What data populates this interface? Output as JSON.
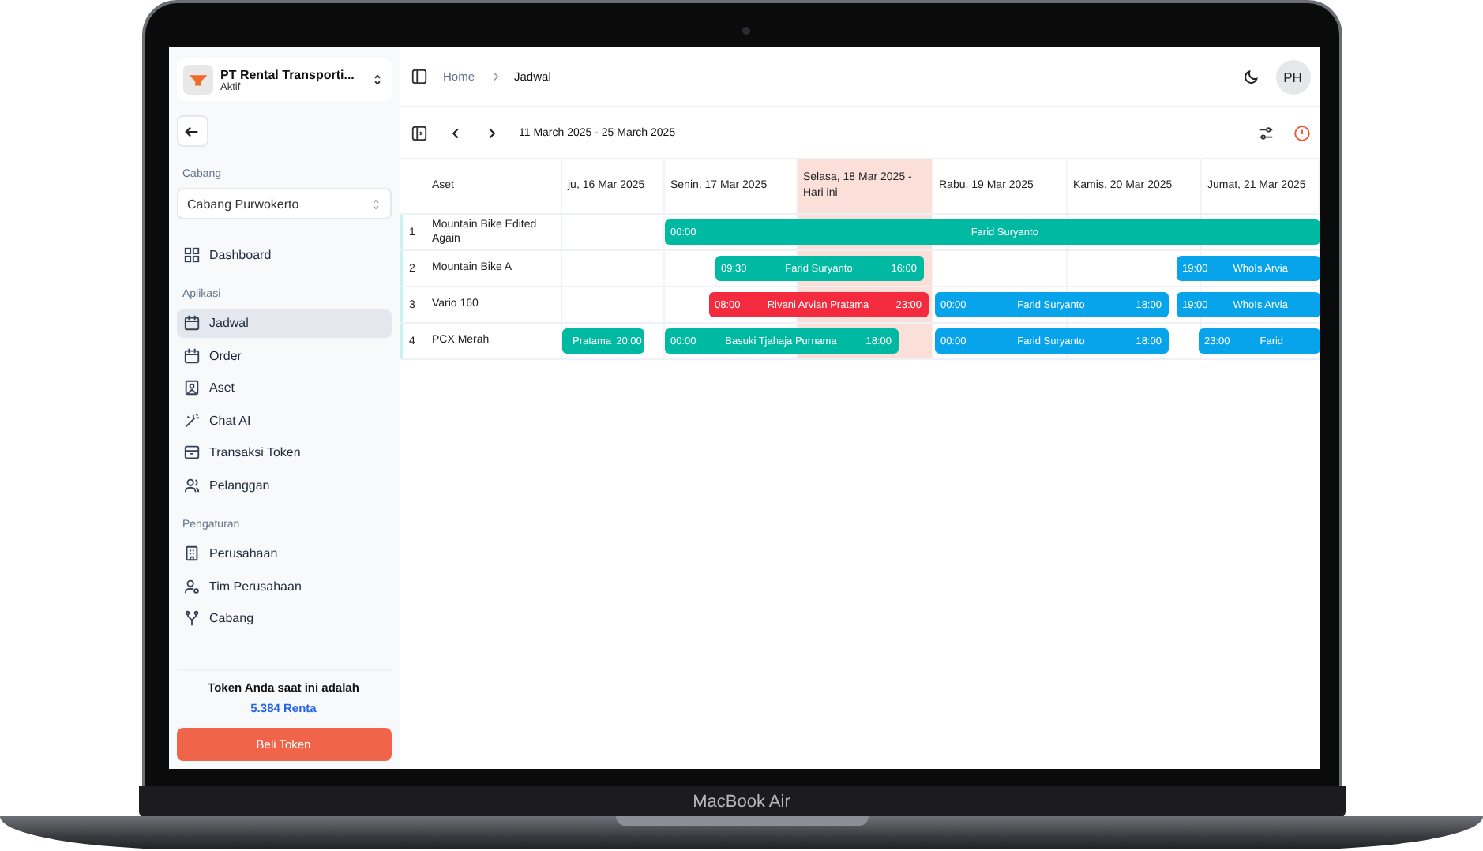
{
  "device": {
    "label": "MacBook Air"
  },
  "sidebar": {
    "company": {
      "name": "PT Rental Transporti...",
      "status": "Aktif"
    },
    "branch_label": "Cabang",
    "branch": "Cabang Purwokerto",
    "top_items": [
      {
        "label": "Dashboard",
        "selected": false
      }
    ],
    "sections": [
      {
        "title": "Aplikasi",
        "items": [
          {
            "label": "Jadwal",
            "selected": true
          },
          {
            "label": "Order",
            "selected": false
          },
          {
            "label": "Aset",
            "selected": false
          },
          {
            "label": "Chat AI",
            "selected": false
          },
          {
            "label": "Transaksi Token",
            "selected": false
          },
          {
            "label": "Pelanggan",
            "selected": false
          }
        ]
      },
      {
        "title": "Pengaturan",
        "items": [
          {
            "label": "Perusahaan",
            "selected": false
          },
          {
            "label": "Tim Perusahaan",
            "selected": false
          },
          {
            "label": "Cabang",
            "selected": false
          }
        ]
      }
    ],
    "token": {
      "text": "Token Anda saat ini adalah",
      "amount": "5.384 Renta"
    },
    "buy_button": "Beli Token"
  },
  "header": {
    "breadcrumbs": [
      "Home",
      "Jadwal"
    ],
    "avatar": "PH"
  },
  "toolbar": {
    "date_range": "11 March 2025 - 25 March 2025"
  },
  "schedule": {
    "asset_column": "Aset",
    "days": [
      {
        "label": "ju, 16 Mar 2025",
        "today": false
      },
      {
        "label": "Senin, 17 Mar 2025",
        "today": false
      },
      {
        "label": "Selasa, 18 Mar 2025 - Hari ini",
        "today": true
      },
      {
        "label": "Rabu, 19 Mar 2025",
        "today": false
      },
      {
        "label": "Kamis, 20 Mar 2025",
        "today": false
      },
      {
        "label": "Jumat, 21 Mar 2025",
        "today": false
      }
    ],
    "rows": [
      {
        "number": "1",
        "asset": "Mountain Bike Edited Again",
        "bookings": [
          {
            "start": "00:00",
            "name": "Farid Suryanto",
            "color": "#00b9a2"
          }
        ]
      },
      {
        "number": "2",
        "asset": "Mountain Bike A",
        "bookings": [
          {
            "start": "09:30",
            "name": "Farid Suryanto",
            "end": "16:00",
            "color": "#00b9a2"
          },
          {
            "start": "19:00",
            "name": "WhoIs Arvia",
            "color": "#07a4ec"
          }
        ]
      },
      {
        "number": "3",
        "asset": "Vario 160",
        "bookings": [
          {
            "start": "08:00",
            "name": "Rivani Arvian Pratama",
            "end": "23:00",
            "color": "#f42b3e"
          },
          {
            "start": "00:00",
            "name": "Farid Suryanto",
            "end": "18:00",
            "color": "#07a4ec"
          },
          {
            "start": "19:00",
            "name": "WhoIs Arvia",
            "color": "#07a4ec"
          }
        ]
      },
      {
        "number": "4",
        "asset": "PCX Merah",
        "bookings": [
          {
            "name": "Pratama",
            "end": "20:00",
            "color": "#00b9a2"
          },
          {
            "start": "00:00",
            "name": "Basuki Tjahaja Purnama",
            "end": "18:00",
            "color": "#00b9a2"
          },
          {
            "start": "00:00",
            "name": "Farid Suryanto",
            "end": "18:00",
            "color": "#07a4ec"
          },
          {
            "start": "23:00",
            "name": "Farid",
            "color": "#07a4ec"
          }
        ]
      }
    ]
  }
}
